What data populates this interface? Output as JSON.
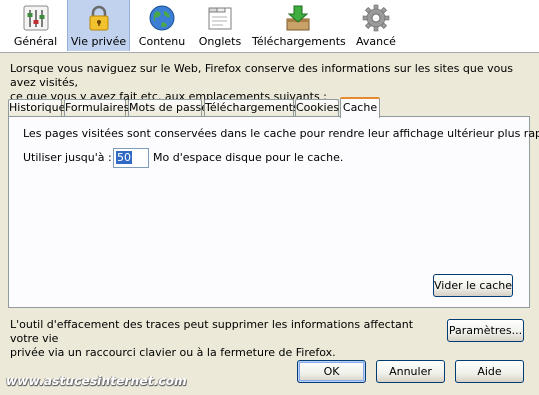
{
  "toolbar": {
    "items": [
      {
        "label": "Général",
        "icon": "settings-sliders-icon",
        "selected": false
      },
      {
        "label": "Vie privée",
        "icon": "padlock-icon",
        "selected": true
      },
      {
        "label": "Contenu",
        "icon": "globe-icon",
        "selected": false
      },
      {
        "label": "Onglets",
        "icon": "tabs-window-icon",
        "selected": false
      },
      {
        "label": "Téléchargements",
        "icon": "download-box-icon",
        "selected": false
      },
      {
        "label": "Avancé",
        "icon": "gear-icon",
        "selected": false
      }
    ]
  },
  "description": {
    "line1": "Lorsque vous naviguez sur le Web, Firefox conserve des informations sur les sites que vous avez visités,",
    "line2": "ce que vous y avez fait etc. aux emplacements suivants :"
  },
  "tabs": [
    {
      "label": "Historique",
      "active": false
    },
    {
      "label": "Formulaires",
      "active": false
    },
    {
      "label": "Mots de passe",
      "active": false
    },
    {
      "label": "Téléchargements",
      "active": false
    },
    {
      "label": "Cookies",
      "active": false
    },
    {
      "label": "Cache",
      "active": true
    }
  ],
  "cache_panel": {
    "info": "Les pages visitées sont conservées dans le cache pour rendre leur affichage ultérieur plus rapide.",
    "use_label": "Utiliser jusqu'à :",
    "use_value": "50",
    "use_suffix": "Mo d'espace disque pour le cache.",
    "clear_button": "Vider le cache"
  },
  "footer": {
    "line1": "L'outil d'effacement des traces peut supprimer les informations affectant votre vie",
    "line2": "privée via un raccourci clavier ou à la fermeture de Firefox.",
    "settings_button": "Paramètres..."
  },
  "dialog_buttons": {
    "ok": "OK",
    "cancel": "Annuler",
    "help": "Aide"
  },
  "watermark": "www.astucesinternet.com",
  "colors": {
    "dialog_bg": "#ece9d8",
    "selected_tab_accent": "#e68b2c",
    "selected_toolbar_bg": "#c1d2ee",
    "selection_highlight": "#316ac5"
  }
}
